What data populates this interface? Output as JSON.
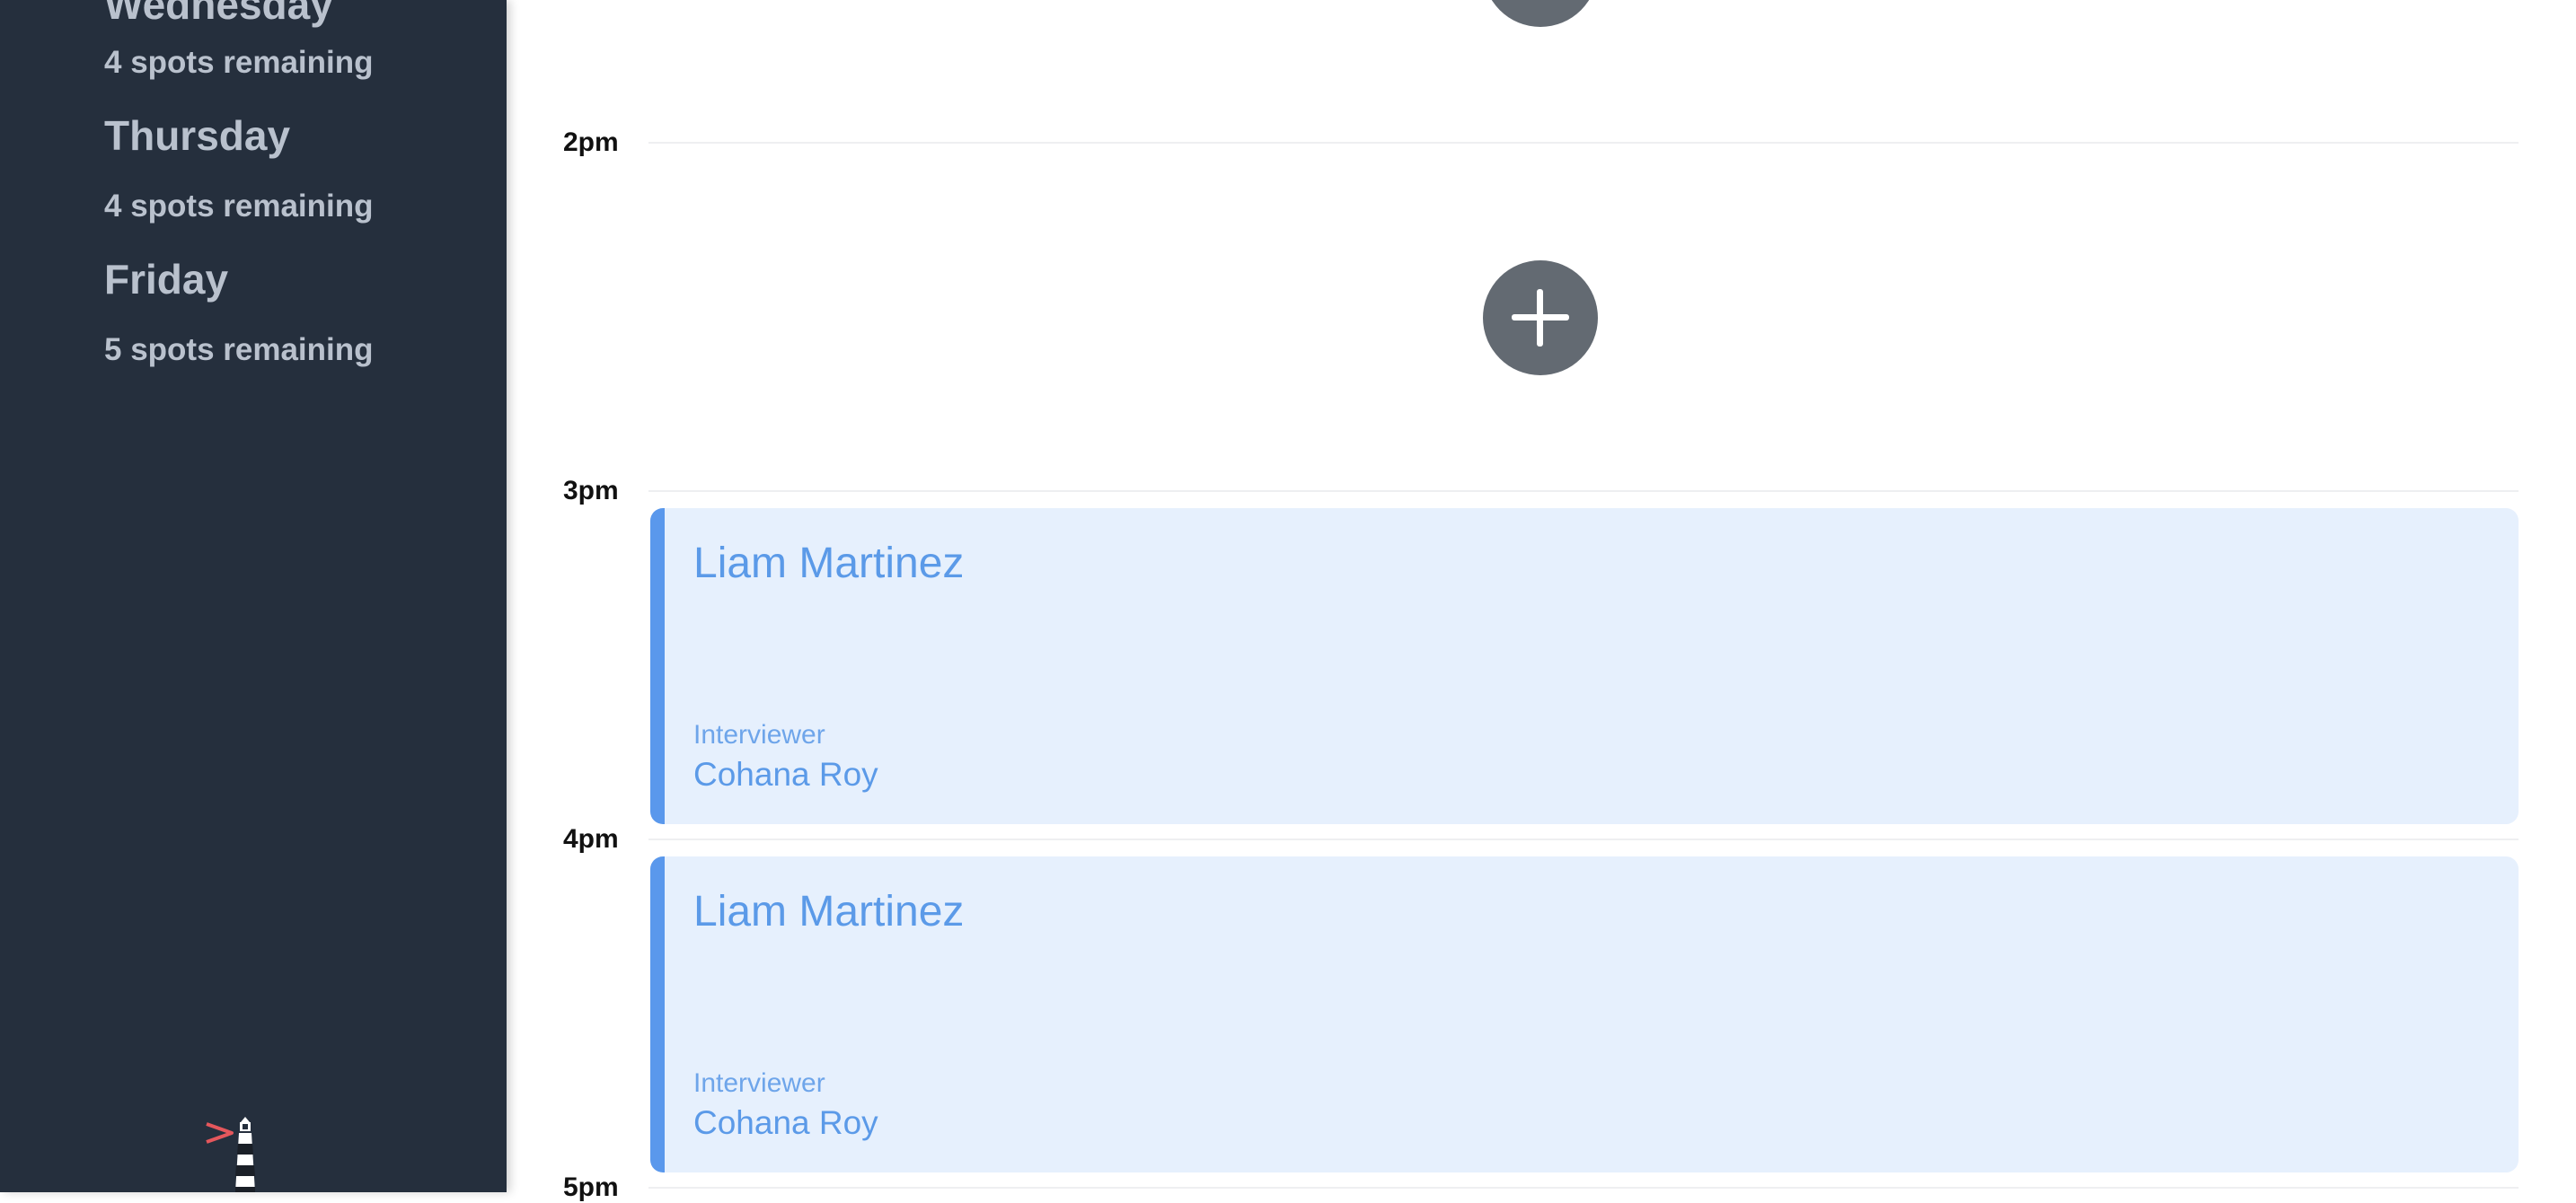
{
  "sidebar": {
    "days": [
      {
        "day": "Wednesday",
        "spots": "4 spots remaining"
      },
      {
        "day": "Thursday",
        "spots": "4 spots remaining"
      },
      {
        "day": "Friday",
        "spots": "5 spots remaining"
      }
    ],
    "logo_icon": "lighthouse-icon",
    "background": "#252f3d",
    "text_color": "#b9c1cd",
    "logo_accent": "#e5575c"
  },
  "schedule": {
    "hours": [
      "2pm",
      "3pm",
      "4pm",
      "5pm"
    ],
    "add_icon": "plus-icon",
    "events": [
      {
        "candidate": "Liam Martinez",
        "role": "Interviewer",
        "interviewer": "Cohana Roy"
      },
      {
        "candidate": "Liam Martinez",
        "role": "Interviewer",
        "interviewer": "Cohana Roy"
      }
    ],
    "event_background": "#e6f0fd",
    "event_accent": "#5a98ec",
    "add_button_color": "#636a72"
  }
}
